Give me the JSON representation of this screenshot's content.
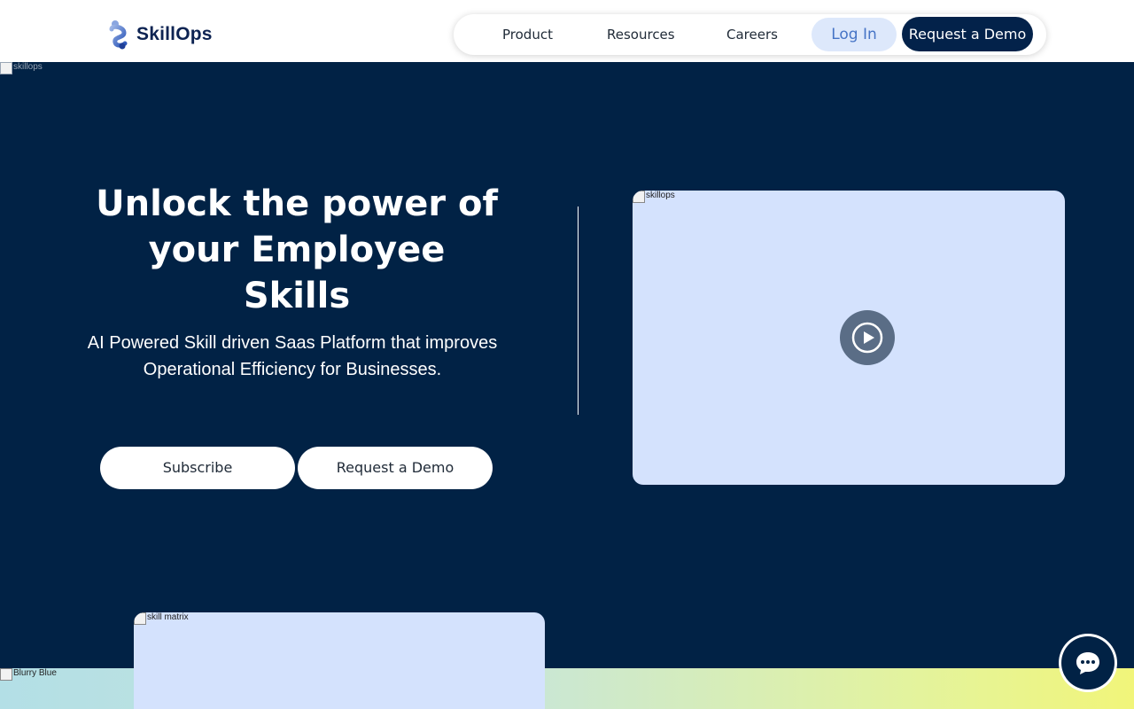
{
  "brand": {
    "name": "SkillOps"
  },
  "nav": {
    "items": [
      "Product",
      "Resources",
      "Careers"
    ],
    "login": "Log In",
    "demo": "Request a Demo"
  },
  "hero": {
    "top_image_alt": "skillops",
    "title_lines": [
      "Unlock the power of",
      "your Employee",
      "Skills"
    ],
    "subtitle_lines": [
      "AI Powered Skill driven Saas Platform that improves",
      "Operational Efficiency for Businesses."
    ],
    "buttons": {
      "subscribe": "Subscribe",
      "demo": "Request a Demo"
    },
    "video_alt": "skillops"
  },
  "bottom": {
    "band_alt": "Blurry Blue",
    "matrix_alt": "skill matrix"
  },
  "colors": {
    "navy": "#012245",
    "login_bg": "#dde8fb",
    "card_bg": "#d4e2fd"
  },
  "icons": {
    "logo": "skillops-logo-icon",
    "play": "play-icon",
    "chat": "chat-bubble-icon"
  }
}
